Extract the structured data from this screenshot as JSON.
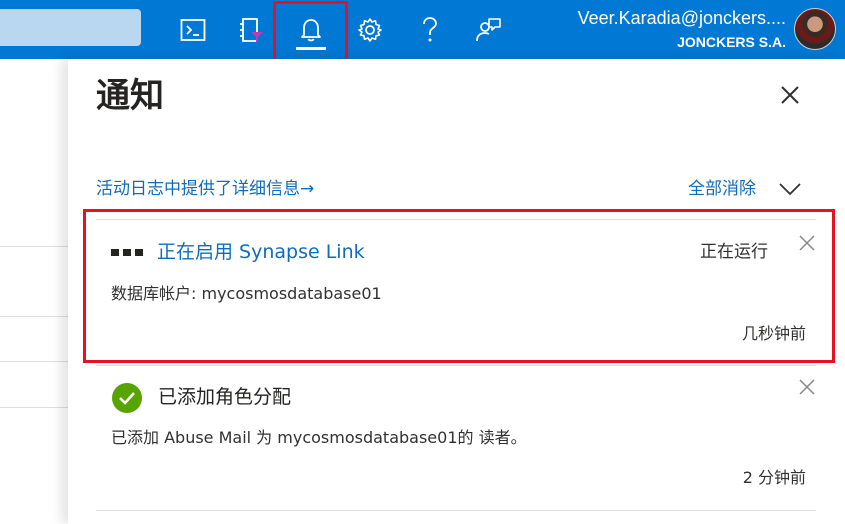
{
  "header": {
    "user_email": "Veer.Karadia@jonckers....",
    "user_org": "JONCKERS S.A.",
    "icons": [
      "cloud-shell-icon",
      "directory-filter-icon",
      "bell-icon",
      "gear-icon",
      "help-icon",
      "feedback-icon"
    ],
    "accent_color": "#0078d4"
  },
  "panel": {
    "title": "通知",
    "activity_link": "活动日志中提供了详细信息→",
    "dismiss_all": "全部消除"
  },
  "notifications": [
    {
      "title": "正在启用 Synapse Link",
      "status": "正在运行",
      "description": "数据库帐户: mycosmosdatabase01",
      "time": "几秒钟前",
      "icon": "progress-dots-icon"
    },
    {
      "title": "已添加角色分配",
      "description": "已添加 Abuse Mail 为 mycosmosdatabase01的 读者。",
      "time": "2 分钟前",
      "icon": "success-check-icon"
    }
  ]
}
